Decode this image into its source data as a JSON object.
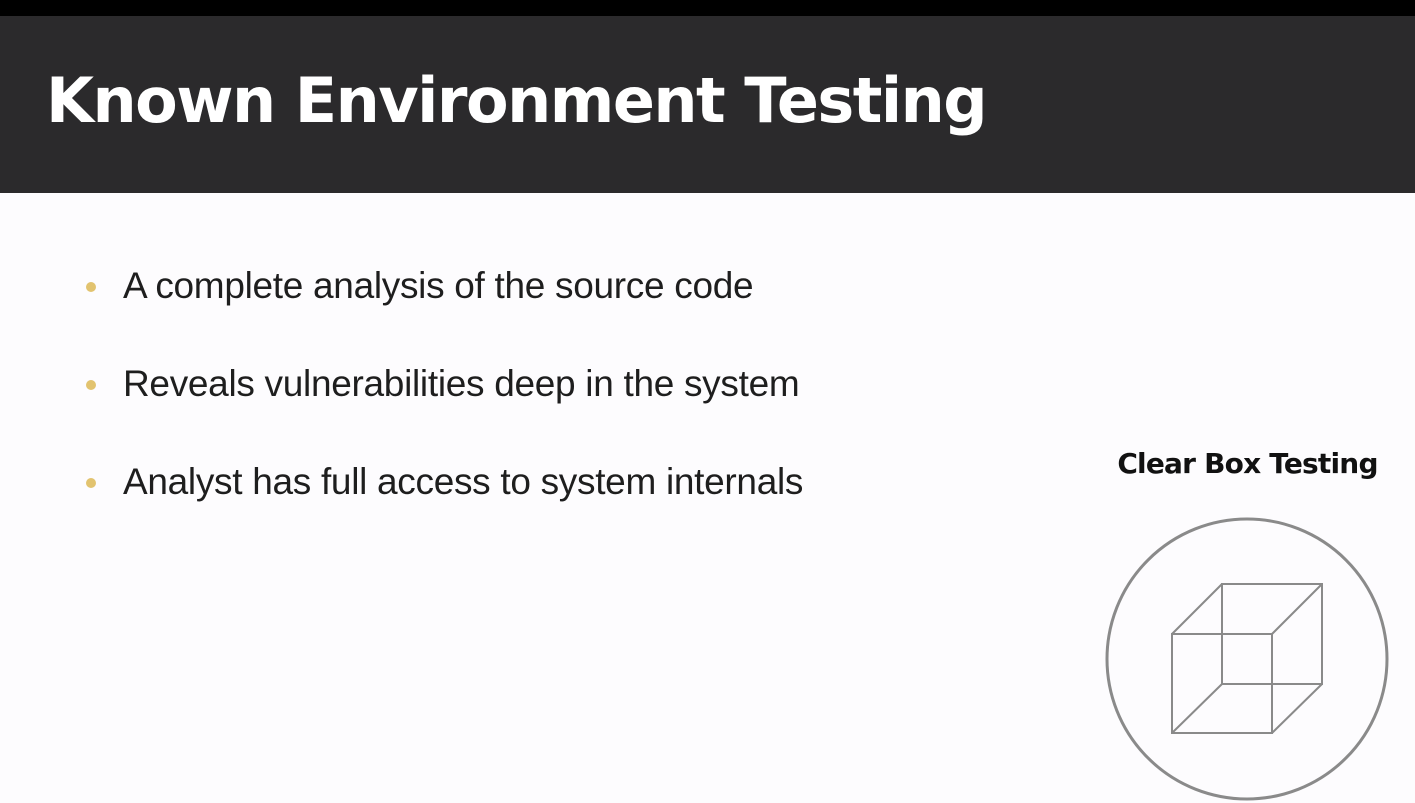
{
  "slide": {
    "title": "Known Environment Testing",
    "bullets": [
      "A complete analysis of the source code",
      "Reveals vulnerabilities deep in the system",
      "Analyst has full access to system internals"
    ],
    "figure": {
      "caption": "Clear Box Testing",
      "icon": "wireframe-cube-icon"
    }
  },
  "colors": {
    "title_bar": "#2b2a2c",
    "title_text": "#ffffff",
    "bullet_dot": "#e2c36f",
    "body_text": "#1e1e1e",
    "background": "#fdfcfe",
    "icon_stroke": "#8a8a8a"
  }
}
